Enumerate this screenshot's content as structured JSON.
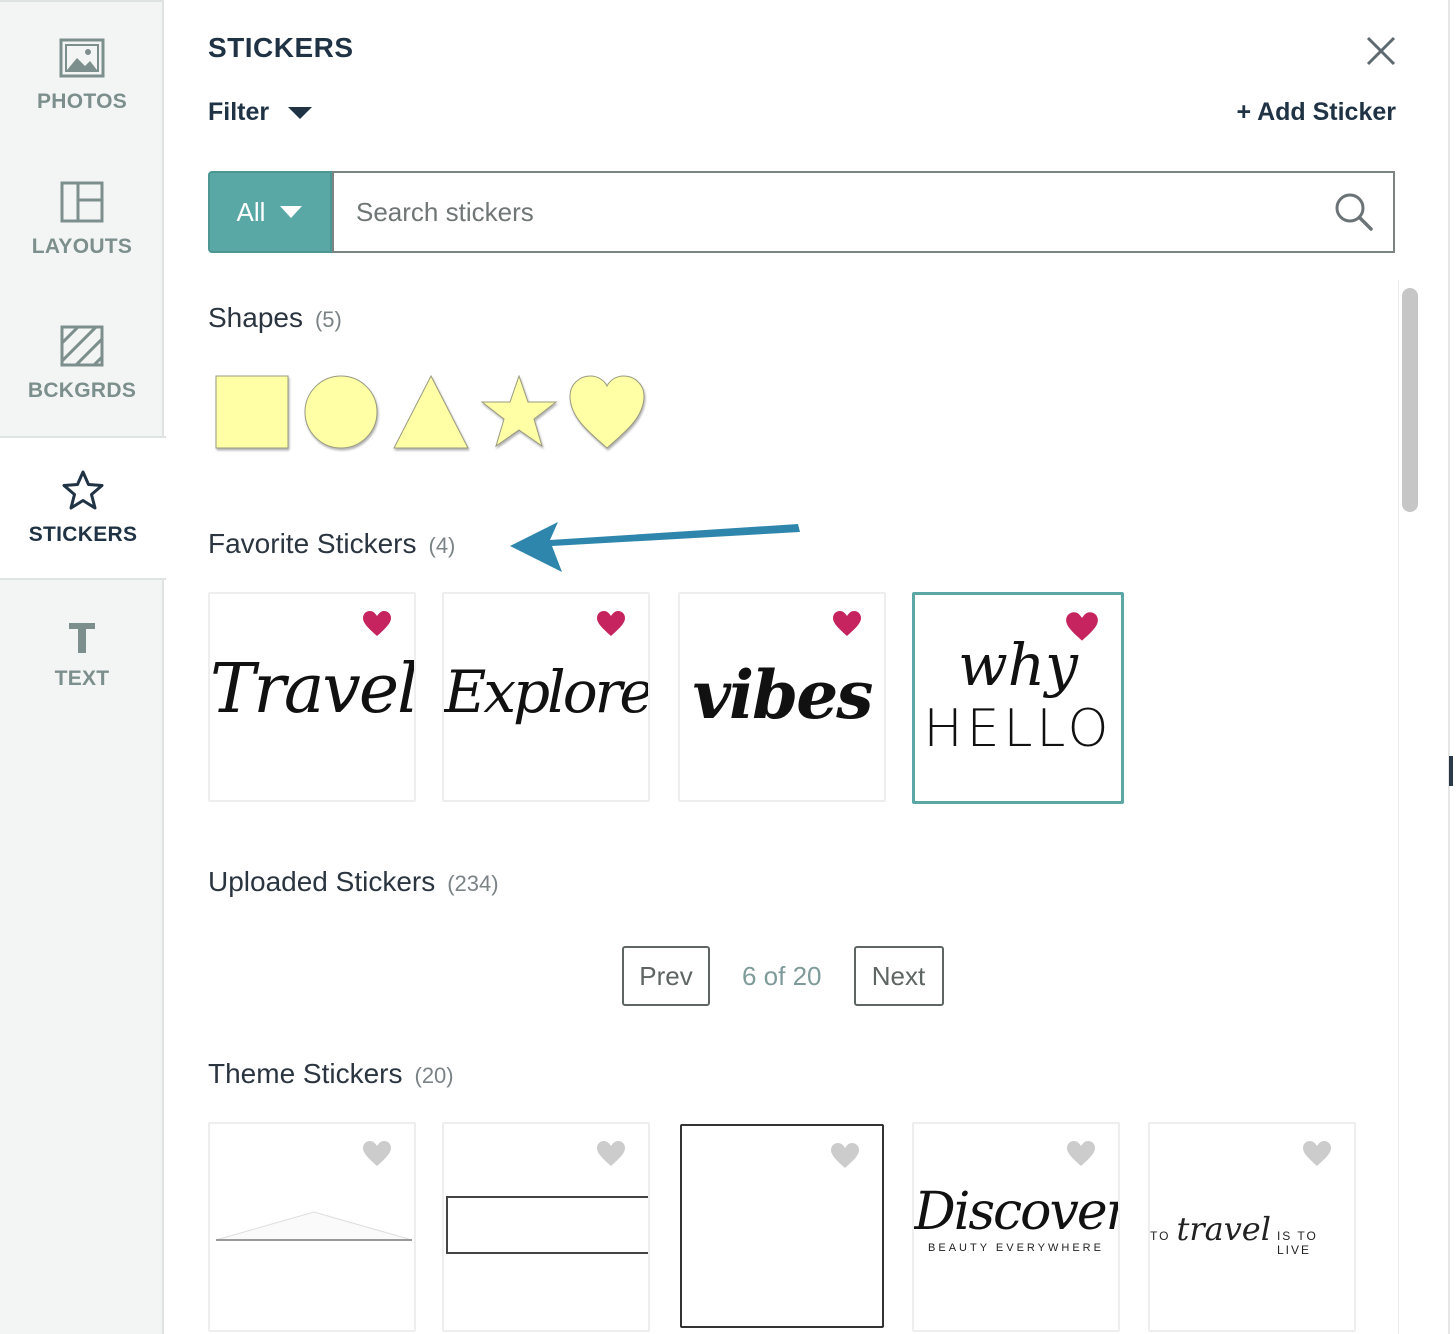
{
  "sidebar": {
    "items": [
      {
        "label": "PHOTOS",
        "icon": "image-icon",
        "active": false
      },
      {
        "label": "LAYOUTS",
        "icon": "layout-icon",
        "active": false
      },
      {
        "label": "BCKGRDS",
        "icon": "background-pattern-icon",
        "active": false
      },
      {
        "label": "STICKERS",
        "icon": "star-icon",
        "active": true
      },
      {
        "label": "TEXT",
        "icon": "text-t-icon",
        "active": false
      }
    ]
  },
  "header": {
    "title": "STICKERS",
    "filter_label": "Filter",
    "add_sticker_label": "+ Add Sticker"
  },
  "search": {
    "category": "All",
    "placeholder": "Search stickers"
  },
  "sections": {
    "shapes": {
      "title": "Shapes",
      "count": "(5)",
      "items": [
        "square",
        "circle",
        "triangle",
        "star",
        "heart"
      ],
      "fill": "#ffffa6"
    },
    "favorites": {
      "title": "Favorite Stickers",
      "count": "(4)",
      "items": [
        {
          "text": "Travel",
          "favorited": true
        },
        {
          "text": "Explore",
          "favorited": true
        },
        {
          "text": "vibes",
          "favorited": true
        },
        {
          "text": "why",
          "text2": "HELLO",
          "favorited": true,
          "selected": true
        }
      ]
    },
    "uploaded": {
      "title": "Uploaded Stickers",
      "count": "(234)"
    },
    "pagination": {
      "prev": "Prev",
      "info": "6 of 20",
      "next": "Next"
    },
    "theme": {
      "title": "Theme Stickers",
      "count": "(20)",
      "items": [
        {
          "kind": "envelope"
        },
        {
          "kind": "banner-rect"
        },
        {
          "kind": "square-frame"
        },
        {
          "text": "Discover",
          "subtext": "BEAUTY EVERYWHERE"
        },
        {
          "pre": "TO",
          "text": "travel",
          "post": "IS TO LIVE"
        }
      ]
    }
  },
  "colors": {
    "accent": "#5aa8a6",
    "heart_favorited": "#c6245e",
    "heart_unfavorited": "#cccccc",
    "annotation_arrow": "#2f86ac"
  }
}
